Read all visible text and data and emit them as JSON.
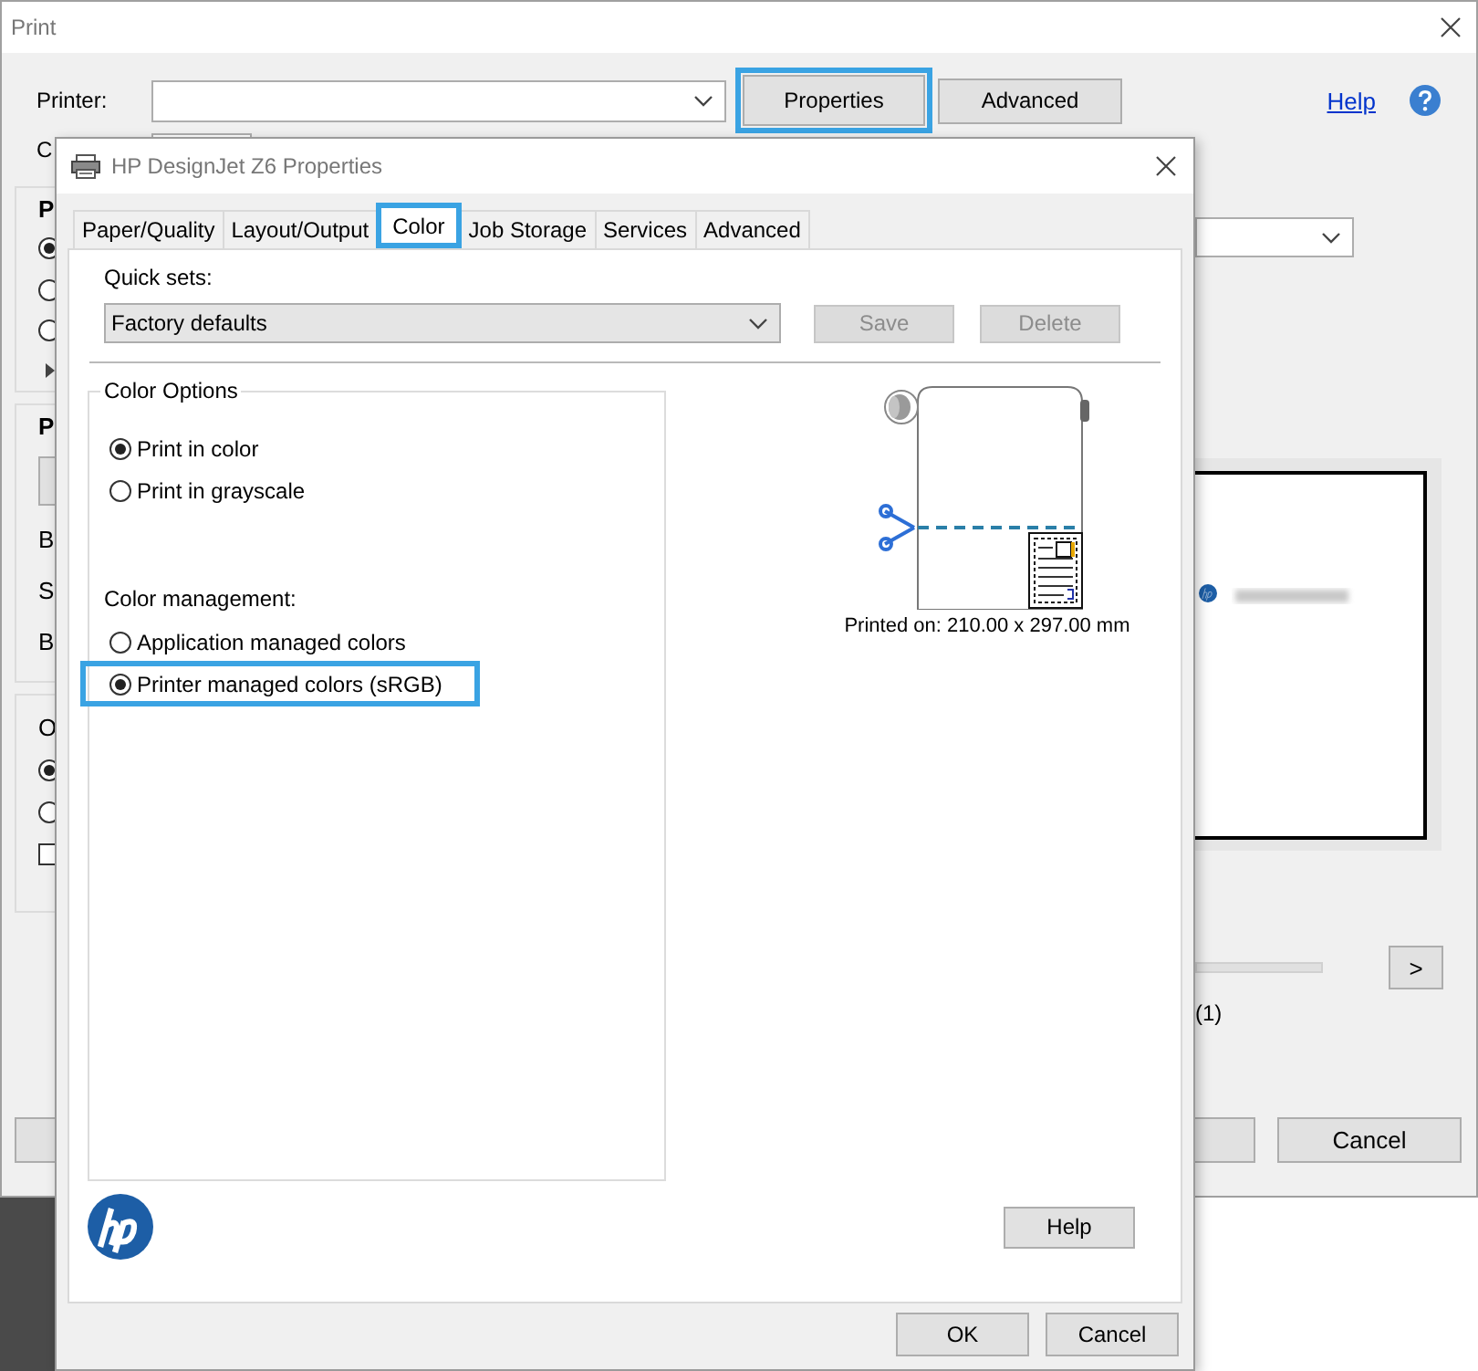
{
  "print_dialog": {
    "title": "Print",
    "printer_label": "Printer:",
    "buttons": [
      {
        "label": "Properties",
        "highlighted": true
      },
      {
        "label": "Advanced",
        "highlighted": false
      }
    ],
    "help_link": "Help",
    "copies_label": "C",
    "groups": [
      {
        "items": [
          {
            "kind": "heading",
            "text": "P"
          },
          {
            "kind": "radio",
            "selected": true
          },
          {
            "kind": "radio",
            "selected": false
          },
          {
            "kind": "radio",
            "selected": false
          },
          {
            "kind": "expander"
          }
        ]
      },
      {
        "items": [
          {
            "kind": "heading",
            "text": "P"
          },
          {
            "kind": "button"
          },
          {
            "kind": "label",
            "text": "B"
          },
          {
            "kind": "label",
            "text": "S"
          },
          {
            "kind": "label",
            "text": "B"
          }
        ]
      },
      {
        "items": [
          {
            "kind": "label",
            "text": "O"
          },
          {
            "kind": "radio",
            "selected": true
          },
          {
            "kind": "radio",
            "selected": false
          },
          {
            "kind": "checkbox",
            "checked": false
          }
        ]
      }
    ],
    "next_button": ">",
    "page_count": "(1)",
    "cancel_button": "Cancel"
  },
  "properties_dialog": {
    "title": "HP DesignJet Z6 Properties",
    "tabs": [
      {
        "label": "Paper/Quality",
        "selected": false,
        "highlighted": false
      },
      {
        "label": "Layout/Output",
        "selected": false,
        "highlighted": false
      },
      {
        "label": "Color",
        "selected": true,
        "highlighted": true
      },
      {
        "label": "Job Storage",
        "selected": false,
        "highlighted": false
      },
      {
        "label": "Services",
        "selected": false,
        "highlighted": false
      },
      {
        "label": "Advanced",
        "selected": false,
        "highlighted": false
      }
    ],
    "quick_sets": {
      "label": "Quick sets:",
      "value": "Factory defaults"
    },
    "quick_set_buttons": [
      {
        "label": "Save",
        "disabled": true
      },
      {
        "label": "Delete",
        "disabled": true
      }
    ],
    "color_options": {
      "title": "Color Options",
      "options": [
        {
          "label": "Print in color",
          "selected": true,
          "highlighted": false
        },
        {
          "label": "Print in grayscale",
          "selected": false,
          "highlighted": false
        }
      ]
    },
    "color_management": {
      "label": "Color management:",
      "options": [
        {
          "label": "Application managed colors",
          "selected": false,
          "highlighted": false
        },
        {
          "label": "Printer managed colors (sRGB)",
          "selected": true,
          "highlighted": true
        }
      ]
    },
    "printed_on": "Printed on: 210.00 x 297.00 mm",
    "help_button": "Help",
    "buttons": [
      "OK",
      "Cancel"
    ]
  }
}
